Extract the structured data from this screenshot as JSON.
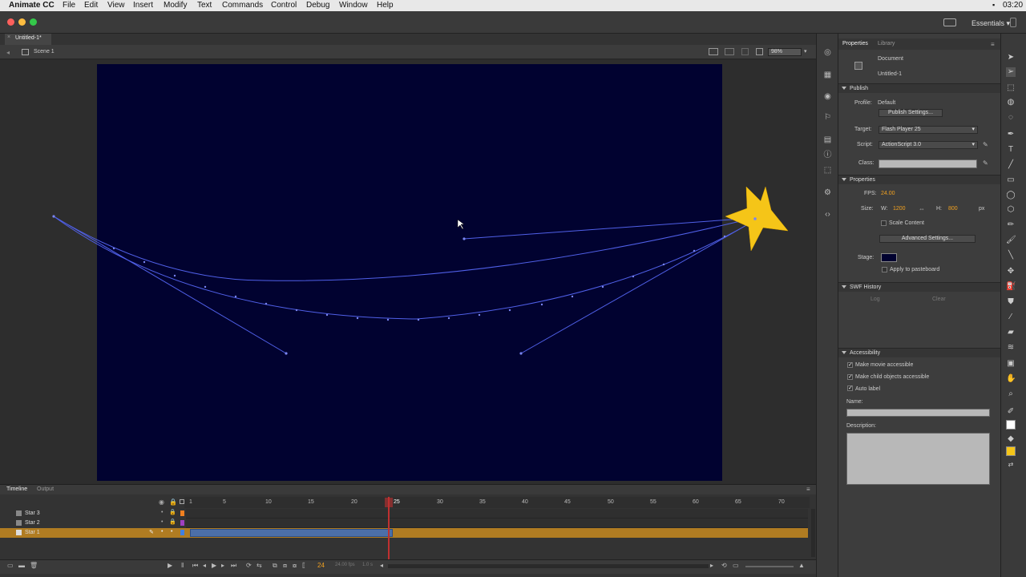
{
  "menubar": {
    "app_name": "Animate CC",
    "items": [
      "File",
      "Edit",
      "View",
      "Insert",
      "Modify",
      "Text",
      "Commands",
      "Control",
      "Debug",
      "Window",
      "Help"
    ],
    "clock": "03:20"
  },
  "appbar": {
    "workspace": "Essentials"
  },
  "document": {
    "tab_title": "Untitled-1*",
    "scene": "Scene 1",
    "zoom": "98%"
  },
  "stage": {
    "background": "#010230",
    "star_color": "#f5c518",
    "path_color": "#5060e8"
  },
  "properties_panel": {
    "tabs": [
      "Properties",
      "Library"
    ],
    "doc_type": "Document",
    "doc_name": "Untitled-1",
    "publish": {
      "header": "Publish",
      "profile_label": "Profile:",
      "profile_value": "Default",
      "publish_settings_btn": "Publish Settings...",
      "target_label": "Target:",
      "target_value": "Flash Player 25",
      "script_label": "Script:",
      "script_value": "ActionScript 3.0",
      "class_label": "Class:"
    },
    "props": {
      "header": "Properties",
      "fps_label": "FPS:",
      "fps_value": "24.00",
      "size_label": "Size:",
      "w_label": "W:",
      "w_value": "1200",
      "h_label": "H:",
      "h_value": "800",
      "unit": "px",
      "scale_content": "Scale Content",
      "advanced_btn": "Advanced Settings...",
      "stage_label": "Stage:",
      "apply_pasteboard": "Apply to pasteboard"
    },
    "swf_history": {
      "header": "SWF History",
      "log_btn": "Log",
      "clear_btn": "Clear"
    },
    "accessibility": {
      "header": "Accessibility",
      "make_movie": "Make movie accessible",
      "make_child": "Make child objects accessible",
      "auto_label": "Auto label",
      "name_label": "Name:",
      "description_label": "Description:"
    }
  },
  "timeline": {
    "tabs": [
      "Timeline",
      "Output"
    ],
    "frame_numbers": [
      "1",
      "5",
      "10",
      "15",
      "20",
      "25",
      "30",
      "35",
      "40",
      "45",
      "50",
      "55",
      "60",
      "65",
      "70"
    ],
    "current_frame": 25,
    "layers": [
      {
        "name": "Star 3",
        "color": "#f08020",
        "selected": false
      },
      {
        "name": "Star 2",
        "color": "#a040c0",
        "selected": false
      },
      {
        "name": "Star 1",
        "color": "#4080e0",
        "selected": true
      }
    ],
    "status_frame": "24",
    "status_fps": "24.00 fps",
    "status_time": "1.0 s"
  },
  "accent_colors": {
    "selected_layer": "#b07c22",
    "tween_span": "#4c6fa8",
    "playhead": "#c03030"
  }
}
